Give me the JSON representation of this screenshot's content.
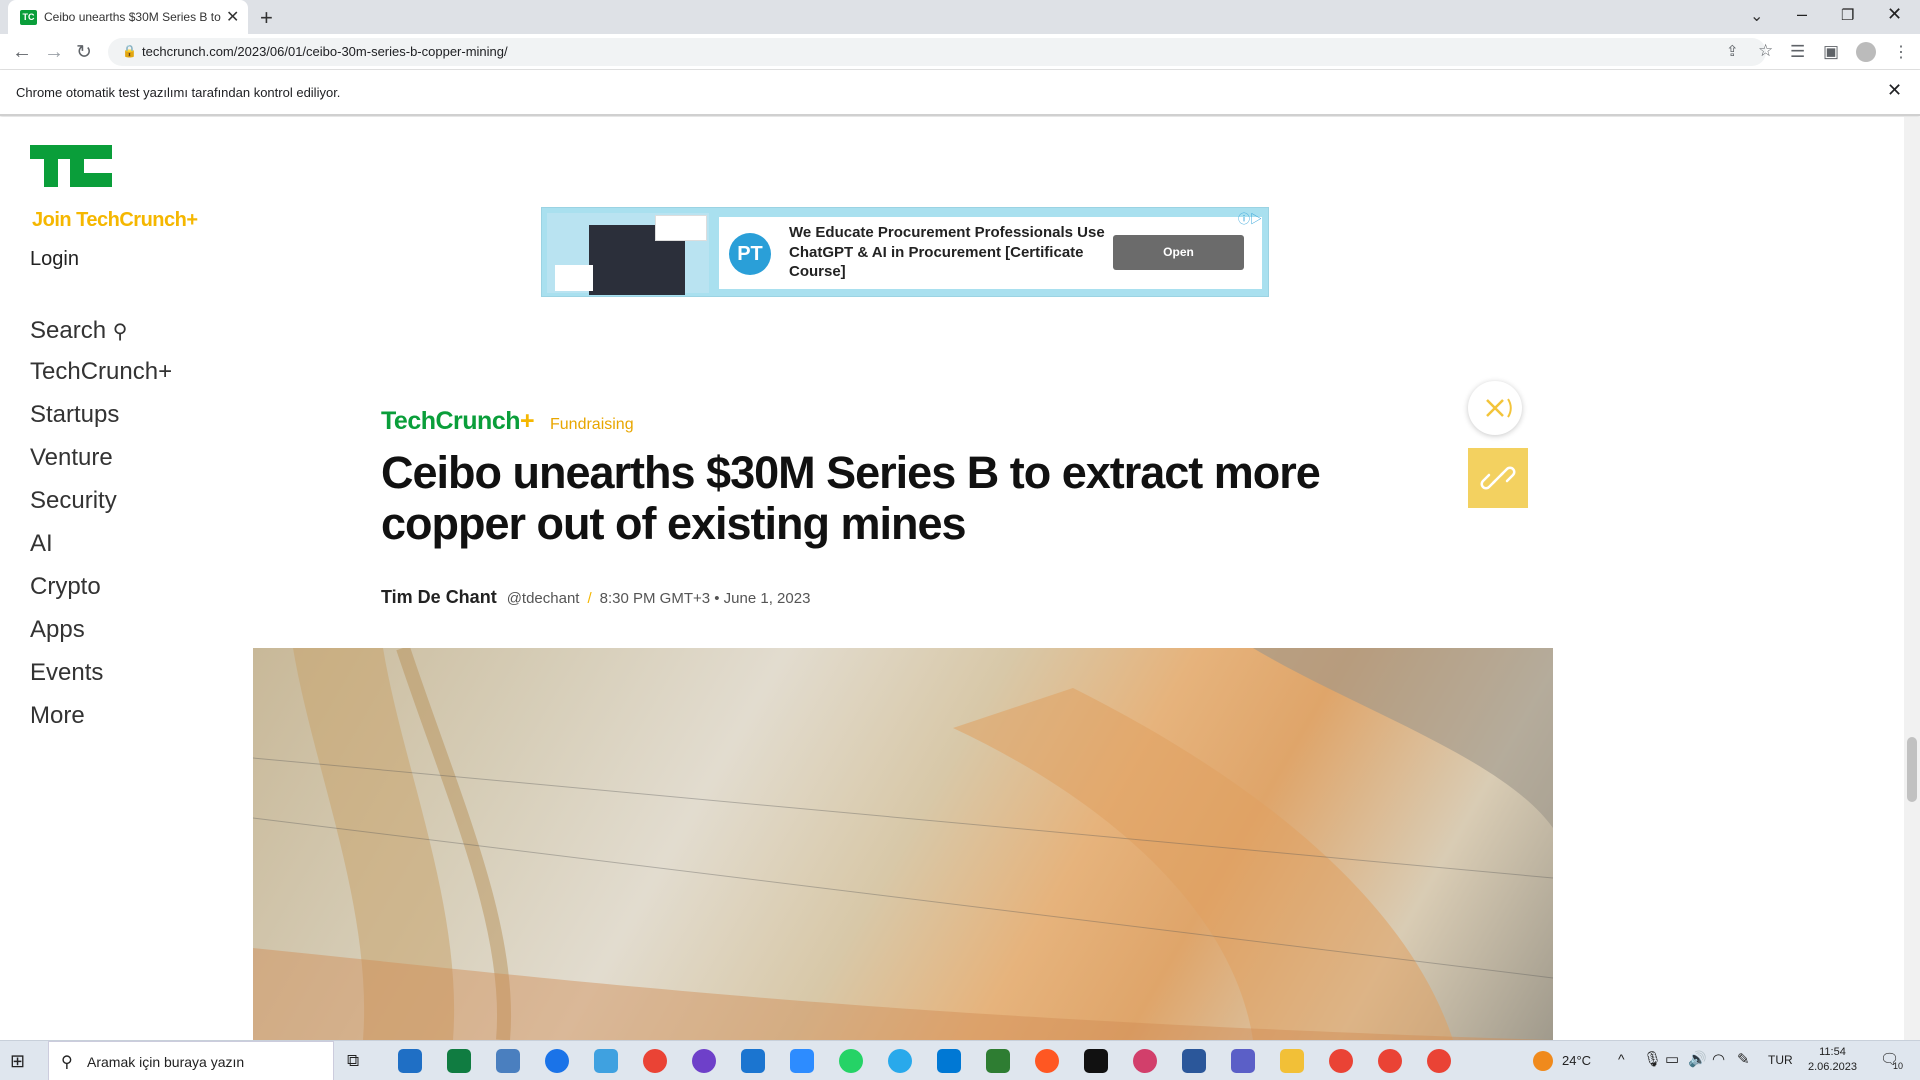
{
  "browser": {
    "tab_title": "Ceibo unearths $30M Series B to",
    "tab_favicon": "TC",
    "url": "techcrunch.com/2023/06/01/ceibo-30m-series-b-copper-mining/",
    "infobar_text": "Chrome otomatik test yazılımı tarafından kontrol ediliyor."
  },
  "site": {
    "join_label": "Join TechCrunch+",
    "login_label": "Login",
    "nav": [
      "Search",
      "TechCrunch+",
      "Startups",
      "Venture",
      "Security",
      "AI",
      "Crypto",
      "Apps",
      "Events",
      "More"
    ]
  },
  "ad": {
    "badge": "PT",
    "text": "We Educate Procurement Professionals Use ChatGPT & AI in Procurement [Certificate Course]",
    "button_label": "Open"
  },
  "article": {
    "brand": "TechCrunch",
    "brand_plus": "+",
    "category": "Fundraising",
    "headline": "Ceibo unearths $30M Series B to extract more copper out of existing mines",
    "author": "Tim De Chant",
    "handle": "@tdechant",
    "separator": "/",
    "timestamp": "8:30 PM GMT+3 • June 1, 2023"
  },
  "taskbar": {
    "search_placeholder": "Aramak için buraya yazın",
    "temperature": "24°C",
    "language": "TUR",
    "time": "11:54",
    "date": "2.06.2023",
    "notification_count": "10"
  },
  "colors": {
    "brand_green": "#0a9e3a",
    "plus_yellow": "#f5b700",
    "link_button": "#f3d160"
  }
}
